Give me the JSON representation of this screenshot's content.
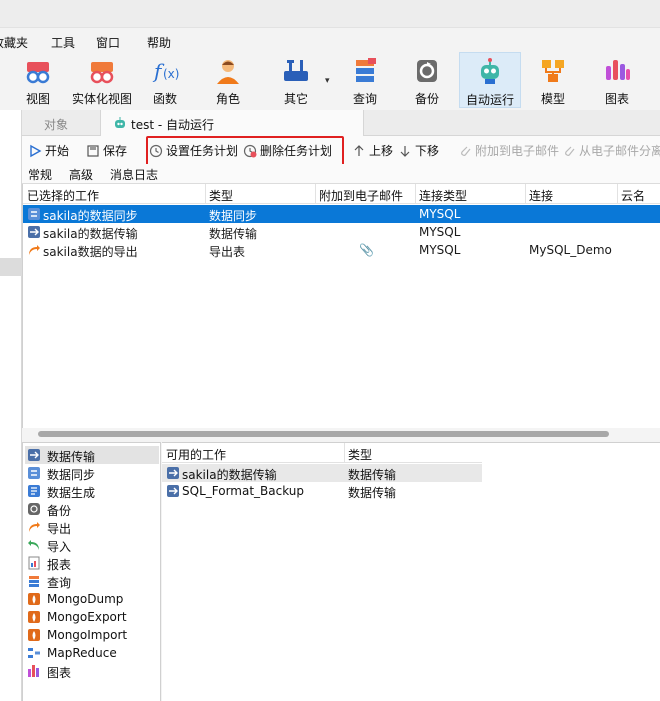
{
  "menu": {
    "items": [
      "收藏夹",
      "工具",
      "窗口",
      "帮助"
    ]
  },
  "toolbar": {
    "buttons": [
      "视图",
      "实体化视图",
      "函数",
      "角色",
      "其它",
      "查询",
      "备份",
      "自动运行",
      "模型",
      "图表"
    ],
    "other_dropdown": "▾"
  },
  "tabs": {
    "object": "对象",
    "active": "test - 自动运行"
  },
  "actions": {
    "start": "开始",
    "save": "保存",
    "set_schedule": "设置任务计划",
    "delete_schedule": "删除任务计划",
    "move_up": "上移",
    "move_down": "下移",
    "attach_email": "附加到电子邮件",
    "detach_email": "从电子邮件分离"
  },
  "subtabs": [
    "常规",
    "高级",
    "消息日志"
  ],
  "selected_jobs": {
    "columns": [
      "已选择的工作",
      "类型",
      "附加到电子邮件",
      "连接类型",
      "连接",
      "云名"
    ],
    "rows": [
      {
        "name": "sakila的数据同步",
        "type": "数据同步",
        "attached": "",
        "conn_type": "MYSQL",
        "conn": ""
      },
      {
        "name": "sakila的数据传输",
        "type": "数据传输",
        "attached": "",
        "conn_type": "MYSQL",
        "conn": ""
      },
      {
        "name": "sakila数据的导出",
        "type": "导出表",
        "attached": "📎",
        "conn_type": "MYSQL",
        "conn": "MySQL_Demo"
      }
    ]
  },
  "job_types": [
    "数据传输",
    "数据同步",
    "数据生成",
    "备份",
    "导出",
    "导入",
    "报表",
    "查询",
    "MongoDump",
    "MongoExport",
    "MongoImport",
    "MapReduce",
    "图表"
  ],
  "available_jobs": {
    "columns": [
      "可用的工作",
      "类型"
    ],
    "rows": [
      {
        "name": "sakila的数据传输",
        "type": "数据传输"
      },
      {
        "name": "SQL_Format_Backup",
        "type": "数据传输"
      }
    ]
  },
  "colors": {
    "selection": "#0a78d7",
    "highlight_box": "#e02020",
    "active_tool": "#dcebf8"
  }
}
